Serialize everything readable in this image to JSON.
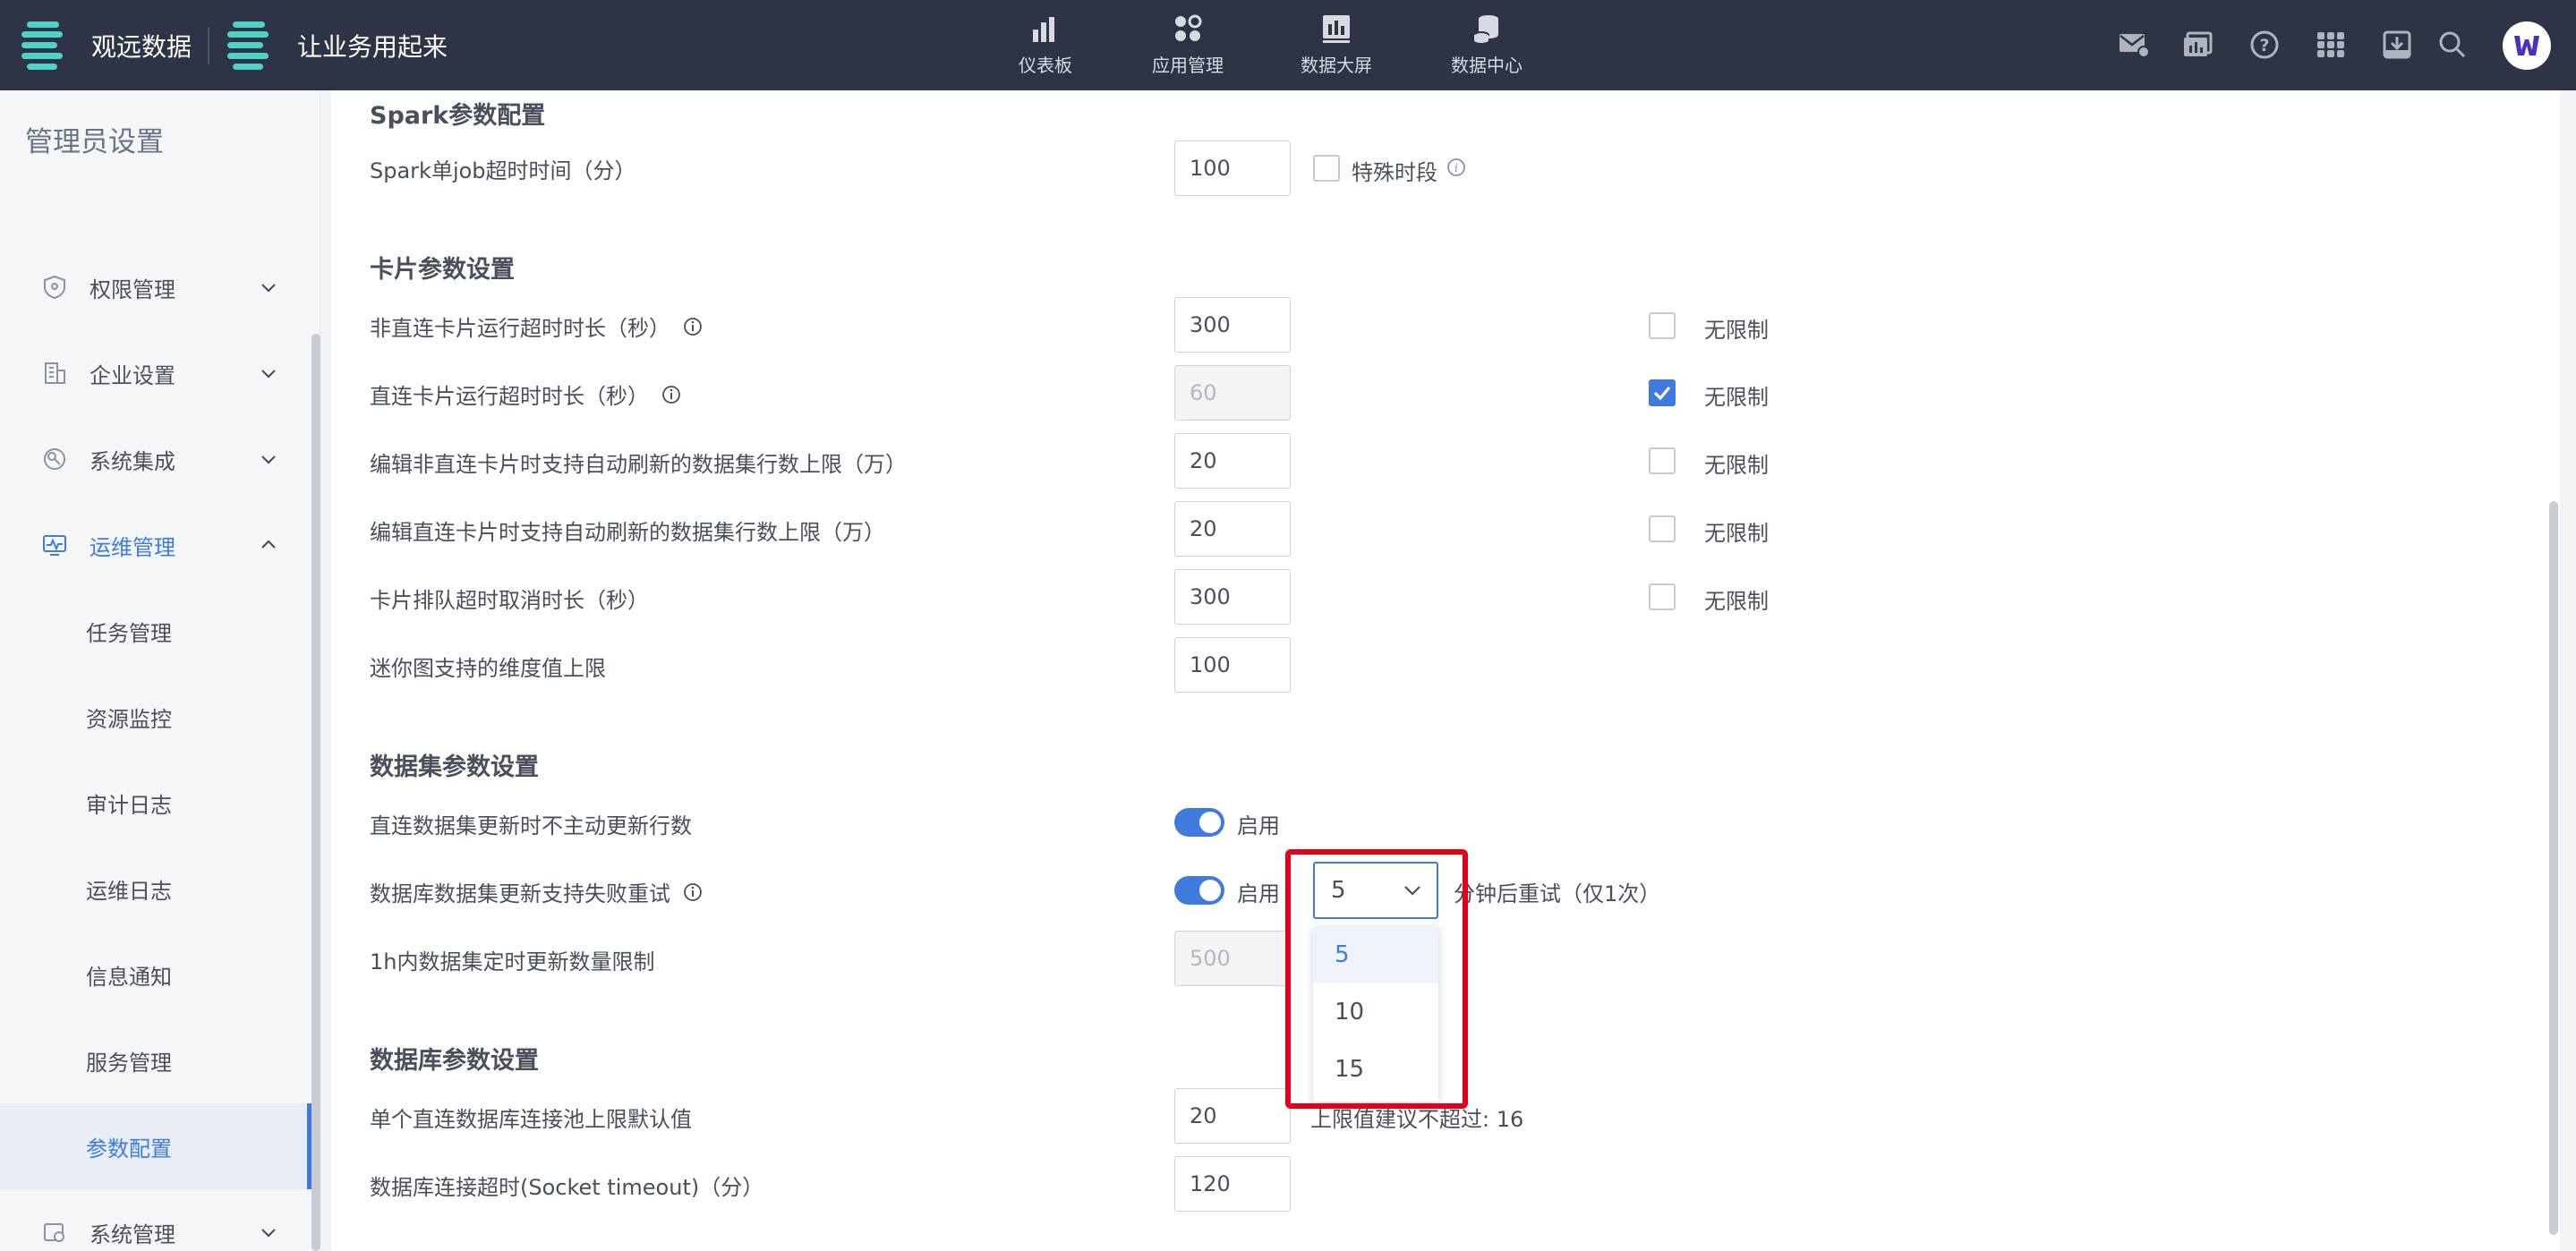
{
  "topbar": {
    "brand1": "观远数据",
    "brand2": "让业务用起来",
    "nav": [
      {
        "label": "仪表板",
        "icon": "bar-chart-icon"
      },
      {
        "label": "应用管理",
        "icon": "apps-icon"
      },
      {
        "label": "数据大屏",
        "icon": "screen-chart-icon"
      },
      {
        "label": "数据中心",
        "icon": "database-icon"
      }
    ],
    "right_icons": [
      "mail-icon",
      "report-icon",
      "help-icon",
      "grid-icon",
      "download-icon",
      "search-icon"
    ]
  },
  "sidebar": {
    "title": "管理员设置",
    "items": [
      {
        "label": "权限管理",
        "icon": "shield-icon"
      },
      {
        "label": "企业设置",
        "icon": "building-icon"
      },
      {
        "label": "系统集成",
        "icon": "integration-icon"
      },
      {
        "label": "运维管理",
        "icon": "monitor-icon"
      },
      {
        "label": "系统管理",
        "icon": "system-icon"
      }
    ],
    "subitems": [
      "任务管理",
      "资源监控",
      "审计日志",
      "运维日志",
      "信息通知",
      "服务管理",
      "参数配置"
    ],
    "active_subitem": "参数配置"
  },
  "main": {
    "spark": {
      "title": "Spark参数配置",
      "label": "Spark单job超时时间（分）",
      "value": "100",
      "check_label": "特殊时段"
    },
    "card": {
      "title": "卡片参数设置",
      "rows": [
        {
          "label": "非直连卡片运行超时时长（秒）",
          "value": "300",
          "check_label": "无限制",
          "checked": false,
          "info": true
        },
        {
          "label": "直连卡片运行超时时长（秒）",
          "value": "60",
          "check_label": "无限制",
          "checked": true,
          "info": true,
          "disabled": true
        },
        {
          "label": "编辑非直连卡片时支持自动刷新的数据集行数上限（万）",
          "value": "20",
          "check_label": "无限制",
          "checked": false
        },
        {
          "label": "编辑直连卡片时支持自动刷新的数据集行数上限（万）",
          "value": "20",
          "check_label": "无限制",
          "checked": false
        },
        {
          "label": "卡片排队超时取消时长（秒）",
          "value": "300",
          "check_label": "无限制",
          "checked": false
        },
        {
          "label": "迷你图支持的维度值上限",
          "value": "100"
        }
      ]
    },
    "dataset": {
      "title": "数据集参数设置",
      "row1_label": "直连数据集更新时不主动更新行数",
      "row1_toggle": "启用",
      "row2_label": "数据库数据集更新支持失败重试",
      "row2_toggle": "启用",
      "row2_select_value": "5",
      "row2_suffix": "分钟后重试（仅1次）",
      "row3_label": "1h内数据集定时更新数量限制",
      "row3_value": "500",
      "dropdown_options": [
        "5",
        "10",
        "15"
      ]
    },
    "database": {
      "title": "数据库参数设置",
      "row1_label": "单个直连数据库连接池上限默认值",
      "row1_value": "20",
      "row1_hint": "上限值建议不超过: 16",
      "row2_label": "数据库连接超时(Socket timeout)（分）",
      "row2_value": "120"
    }
  },
  "colors": {
    "topbar": "#2d3446",
    "accent": "#3e7bdd",
    "highlight": "#e3001b"
  }
}
